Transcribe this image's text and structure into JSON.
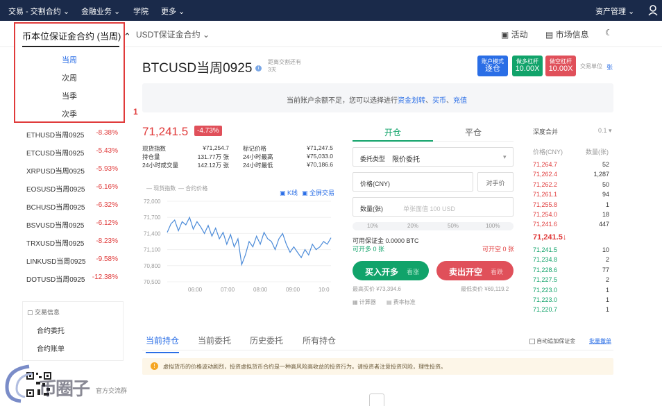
{
  "topnav": {
    "trade": "交易 - 交割合约",
    "finance": "金融业务",
    "academy": "学院",
    "more": "更多",
    "assets": "资产管理"
  },
  "subnav": {
    "coin_contract": "币本位保证金合约 (当周)",
    "usdt_contract": "USDT保证金合约",
    "activity": "活动",
    "market_info": "市场信息"
  },
  "dropdown": {
    "items": [
      "当周",
      "次周",
      "当季",
      "次季"
    ],
    "annotation": "1"
  },
  "contracts": [
    {
      "name": "ETHUSD当周0925",
      "change": "-8.38%"
    },
    {
      "name": "ETCUSD当周0925",
      "change": "-5.43%"
    },
    {
      "name": "XRPUSD当周0925",
      "change": "-5.93%"
    },
    {
      "name": "EOSUSD当周0925",
      "change": "-6.16%"
    },
    {
      "name": "BCHUSD当周0925",
      "change": "-6.32%"
    },
    {
      "name": "BSVUSD当周0925",
      "change": "-6.12%"
    },
    {
      "name": "TRXUSD当周0925",
      "change": "-8.23%"
    },
    {
      "name": "LINKUSD当周0925",
      "change": "-9.58%"
    },
    {
      "name": "DOTUSD当周0925",
      "change": "-12.38%"
    }
  ],
  "left_box": {
    "title": "交易信息",
    "items": [
      "合约委托",
      "合约账单"
    ]
  },
  "footer": {
    "group_label": "官方交流群",
    "watermark": "币圈子"
  },
  "header": {
    "symbol": "BTCUSD当周0925",
    "delivery_label": "距离交割还有",
    "delivery_value": "3天",
    "account_mode_label": "账户模式",
    "account_mode_value": "逐仓",
    "long_label": "做多杠杆",
    "long_value": "10.00X",
    "short_label": "做空杠杆",
    "short_value": "10.00X",
    "unit_label": "交易单位",
    "unit_value": "张"
  },
  "notice": {
    "text": "当前账户余额不足，您可以选择进行",
    "link1": "资金划转",
    "sep": "、",
    "link2": "买币",
    "sep2": "、",
    "link3": "充值"
  },
  "ticker": {
    "price": "71,241.5",
    "change": "-4.73%",
    "stats": [
      {
        "label": "现货指数",
        "value": "¥71,254.7",
        "label2": "标记价格",
        "value2": "¥71,247.5"
      },
      {
        "label": "持仓量",
        "value": "131.77万 张",
        "label2": "24小时最高",
        "value2": "¥75,033.0"
      },
      {
        "label": "24小时成交量",
        "value": "142.12万 张",
        "label2": "24小时最低",
        "value2": "¥70,186.6"
      }
    ]
  },
  "chart_data": {
    "type": "line",
    "legend": [
      "现货指数",
      "合约价格"
    ],
    "kline": "K线",
    "fullscreen": "全屏交易",
    "x_ticks": [
      "06:00",
      "07:00",
      "08:00",
      "09:00",
      "10:0"
    ],
    "y_ticks": [
      "72,000",
      "71,700",
      "71,400",
      "71,100",
      "70,800",
      "70,500"
    ],
    "ylim": [
      70500,
      72000
    ],
    "series": [
      {
        "name": "合约价格",
        "values": [
          71420,
          71580,
          71650,
          71450,
          71620,
          71560,
          71700,
          71480,
          71620,
          71520,
          71400,
          71550,
          71350,
          71500,
          71300,
          71420,
          71200,
          71380,
          71150,
          71300,
          70820,
          71000,
          71250,
          71150,
          71350,
          71200,
          71420,
          71300,
          71250,
          71100,
          71300,
          71400,
          71200,
          71050,
          71150,
          71050,
          70950,
          71100,
          71000,
          71200,
          71100,
          71150,
          71250,
          71200,
          71320
        ]
      }
    ]
  },
  "order": {
    "tab_open": "开仓",
    "tab_close": "平仓",
    "type_label": "委托类型",
    "type_value": "限价委托",
    "price_label": "价格(CNY)",
    "opp_label": "对手价",
    "qty_label": "数量(张)",
    "qty_placeholder": "单张面值 100 USD",
    "pcts": [
      "10%",
      "20%",
      "50%",
      "100%"
    ],
    "margin_label": "可用保证金 0.0000 BTC",
    "can_long": "可开多 0 张",
    "can_short": "可开空 0 张",
    "buy_label": "买入开多",
    "buy_sub": "看涨",
    "sell_label": "卖出开空",
    "sell_sub": "看跌",
    "max_buy": "最高买价 ¥73,394.6",
    "min_sell": "最低卖价 ¥69,119.2",
    "calc": "计算器",
    "fee": "费率标准"
  },
  "orderbook": {
    "title": "深度合并",
    "precision": "0.1",
    "col_price": "价格(CNY)",
    "col_qty": "数量(张)",
    "asks": [
      [
        "71,264.7",
        "52"
      ],
      [
        "71,262.4",
        "1,287"
      ],
      [
        "71,262.2",
        "50"
      ],
      [
        "71,261.1",
        "94"
      ],
      [
        "71,255.8",
        "1"
      ],
      [
        "71,254.0",
        "18"
      ],
      [
        "71,241.6",
        "447"
      ]
    ],
    "last": "71,241.5↓",
    "bids": [
      [
        "71,241.5",
        "10"
      ],
      [
        "71,234.8",
        "2"
      ],
      [
        "71,228.6",
        "77"
      ],
      [
        "71,227.5",
        "2"
      ],
      [
        "71,223.0",
        "1"
      ],
      [
        "71,223.0",
        "1"
      ],
      [
        "71,220.7",
        "1"
      ]
    ]
  },
  "bottom_tabs": {
    "tabs": [
      "当前持仓",
      "当前委托",
      "历史委托",
      "所有持仓"
    ],
    "auto_margin": "自动追加保证金",
    "batch_cancel": "批量撤单"
  },
  "risk": {
    "text": "虚拟货币的价格波动剧烈，投资虚拟货币合约是一种高风险高收益的投资行为。请投资者注意投资风险，理性投资。"
  },
  "colors": {
    "navy": "#1a2a4a",
    "green": "#11a36a",
    "red": "#e03a3a",
    "blue": "#2a6ee6"
  }
}
